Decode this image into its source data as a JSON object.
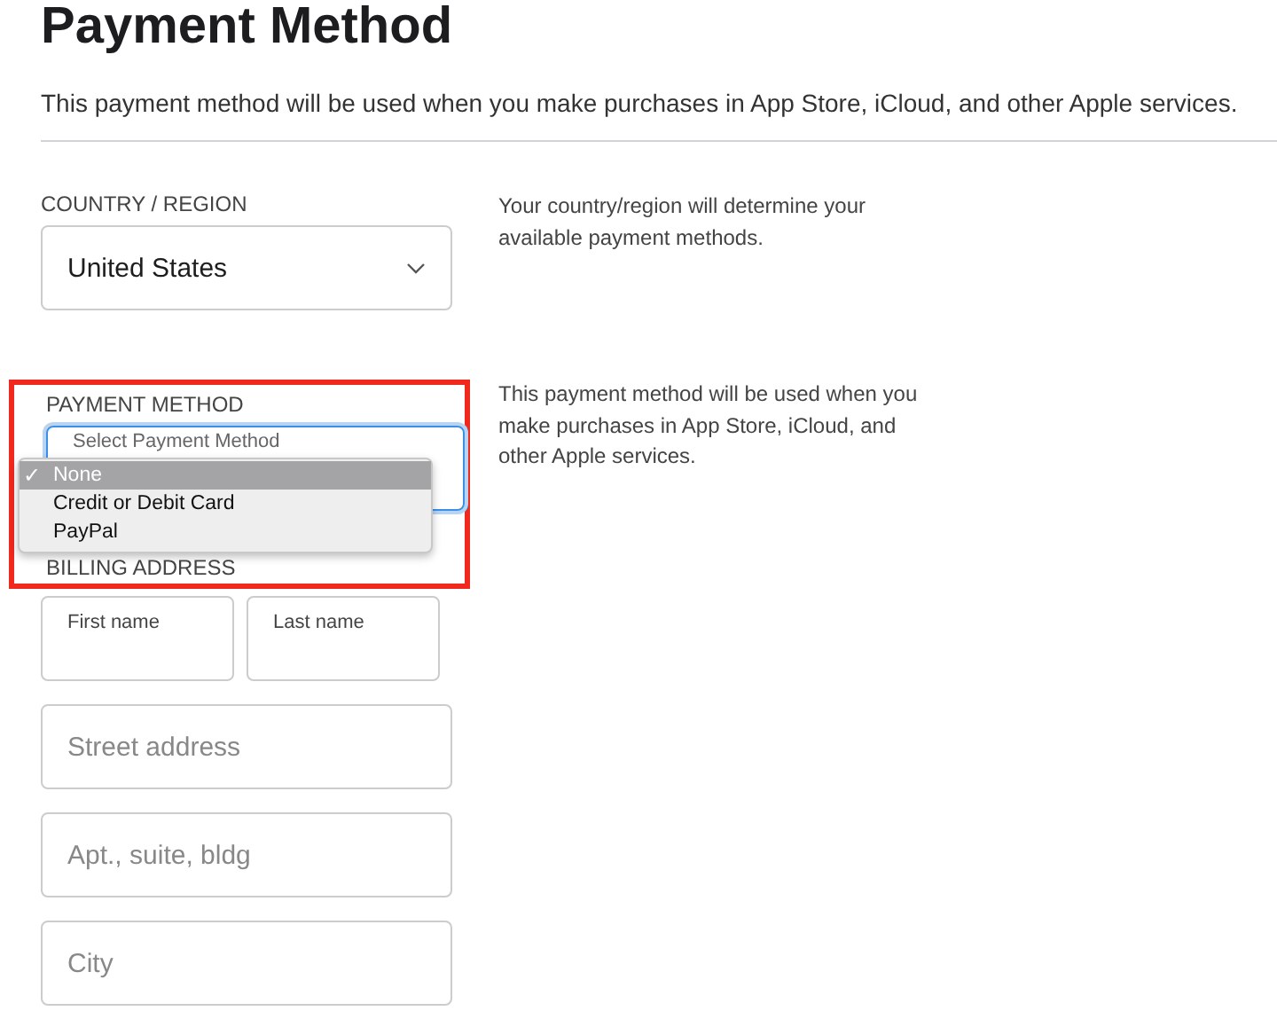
{
  "title": "Payment Method",
  "intro": "This payment method will be used when you make purchases in App Store, iCloud, and other Apple services.",
  "country": {
    "label": "COUNTRY / REGION",
    "value": "United States",
    "note": "Your country/region will determine your available payment methods."
  },
  "payment": {
    "label": "PAYMENT METHOD",
    "placeholder": "Select Payment Method",
    "note": "This payment method will be used when you make purchases in App Store, iCloud, and other Apple services.",
    "highlighted": true,
    "check_mark": "✓",
    "options": [
      {
        "label": "None",
        "selected": true
      },
      {
        "label": "Credit or Debit Card",
        "selected": false
      },
      {
        "label": "PayPal",
        "selected": false
      }
    ]
  },
  "billing": {
    "label": "BILLING ADDRESS",
    "name_fields": [
      {
        "placeholder": "First name"
      },
      {
        "placeholder": "Last name"
      }
    ],
    "fields": [
      {
        "placeholder": "Street address"
      },
      {
        "placeholder": "Apt., suite, bldg"
      },
      {
        "placeholder": "City"
      }
    ]
  }
}
